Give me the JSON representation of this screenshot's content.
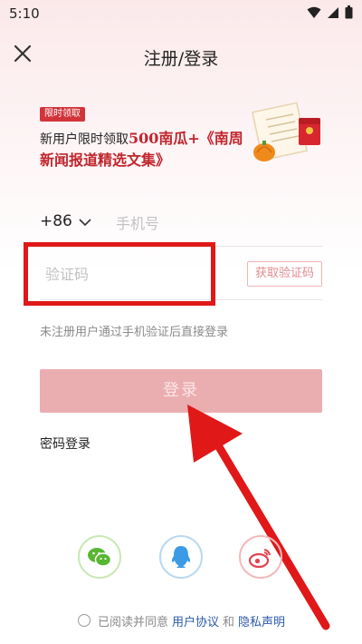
{
  "status_bar": {
    "time": "5:10"
  },
  "nav": {
    "title": "注册/登录"
  },
  "promo": {
    "tag": "限时领取",
    "line1_prefix": "新用户限时领取",
    "line1_highlight": "500南瓜+《南周",
    "line2": "新闻报道精选文集》"
  },
  "phone": {
    "country_code": "+86",
    "placeholder": "手机号"
  },
  "verify": {
    "placeholder": "验证码",
    "get_code_label": "获取验证码"
  },
  "hint": "未注册用户通过手机验证后直接登录",
  "login_button": "登录",
  "password_login": "密码登录",
  "social": [
    "wechat-icon",
    "qq-icon",
    "weibo-icon"
  ],
  "agreement": {
    "prefix": "已阅读并同意",
    "terms": "用户协议",
    "and": "和",
    "privacy": "隐私声明"
  },
  "colors": {
    "accent": "#c0252c",
    "login_disabled": "#eaaeb1",
    "link": "#2c5aa8",
    "annotation_red": "#e01818"
  }
}
